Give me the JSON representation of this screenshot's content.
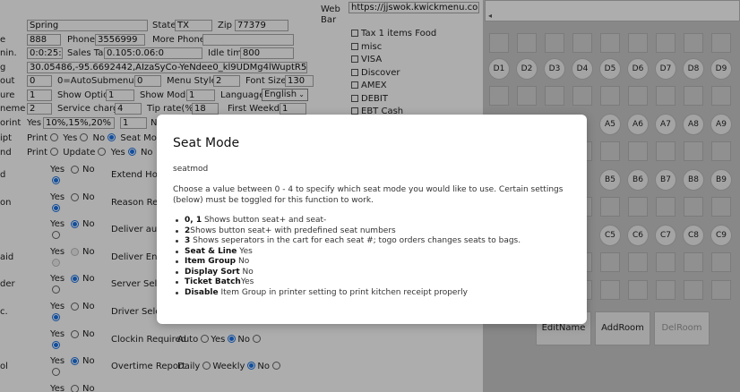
{
  "left": {
    "row1": {
      "edge": "",
      "city": "Spring",
      "state_label": "State",
      "state": "TX",
      "zip_label": "Zip",
      "zip": "77379"
    },
    "row2": {
      "edge": "e",
      "value1": "888",
      "phone_label": "Phone",
      "phone": "3556999",
      "more_phones_label": "More Phones",
      "more_phones": ""
    },
    "row3": {
      "edge": "nin.",
      "value1": "0:0:25:2",
      "sales_tax_label": "Sales Tax",
      "sales_tax": "0.105:0.06:0",
      "idle_label": "Idle time",
      "idle": "800"
    },
    "row4": {
      "edge": "g",
      "value1": "30.05486,-95.6692442,AIzaSyCo-YeNdee0_kl9UDMg4lWuptR5dTggku"
    },
    "row5": {
      "edge": "out",
      "value1": "0",
      "auto_label": "0=Auto",
      "submenu_label": "Submenu",
      "submenu": "0",
      "menu_style_label": "Menu Style",
      "menu_style": "2",
      "font_size_label": "Font Size",
      "font_size": "130"
    },
    "row6": {
      "edge": "ure",
      "value1": "1",
      "show_option_label": "Show Option",
      "show_option": "1",
      "show_modify_label": "Show Modify",
      "show_modify": "1",
      "language_label": "Language",
      "language": "English"
    },
    "row7": {
      "edge": "neme",
      "value1": "2",
      "service_charge_label": "Service charge",
      "service_charge": "4",
      "tip_rate_label": "Tip rate(%)",
      "tip_rate": "18",
      "first_weekday_label": "First Weekday",
      "first_weekday": "1"
    },
    "row8": {
      "edge": "orint",
      "yes_label": "Yes",
      "yes_value": "10%,15%,20%",
      "value2": "1",
      "trail": "N"
    },
    "row9": {
      "edge": "ipt",
      "print_label": "Print",
      "yes": "Yes",
      "no": "No",
      "trail": "Seat Mo"
    },
    "row10": {
      "edge": "nd",
      "print_label": "Print",
      "update": "Update",
      "yes": "Yes",
      "trail": "No"
    },
    "rows": [
      {
        "edge": "d",
        "yes": "Yes",
        "no": "No",
        "label": "Extend Hour"
      },
      {
        "edge": "on",
        "yes": "Yes",
        "no": "No",
        "label": "Reason Requ"
      },
      {
        "edge": "",
        "yes": "Yes",
        "no": "No",
        "label": "Deliver auto"
      },
      {
        "edge": "aid",
        "yes": "Yes",
        "no": "No",
        "label": "Deliver Enab"
      },
      {
        "edge": "der",
        "yes": "Yes",
        "no": "No",
        "label": "Server Select"
      },
      {
        "edge": "c.",
        "yes": "Yes",
        "no": "No",
        "label": "Driver Select"
      },
      {
        "edge": "",
        "yes": "Yes",
        "no": "No",
        "label": "Clockin Required",
        "opt_auto": "Auto",
        "opt_yes": "Yes",
        "opt_no": "No"
      },
      {
        "edge": "ol",
        "yes": "Yes",
        "no": "No",
        "label": "Overtime Report",
        "opt_daily": "Daily",
        "opt_weekly": "Weekly",
        "opt_no": "No"
      },
      {
        "edge": "",
        "yes": "Yes",
        "no": "No"
      }
    ]
  },
  "mid": {
    "web_label": "Web",
    "web_url": "https://jjswok.kwickmenu.com/",
    "bar_label": "Bar",
    "checkboxes": [
      "Tax 1 items Food",
      "misc",
      "VISA",
      "Discover",
      "AMEX",
      "DEBIT",
      "EBT Cash"
    ]
  },
  "grid": {
    "scroll_mark": "◂",
    "row_d": [
      "D1",
      "D2",
      "D3",
      "D4",
      "D5",
      "D6",
      "D7",
      "D8",
      "D9"
    ],
    "row_a": [
      "A5",
      "A6",
      "A7",
      "A8",
      "A9"
    ],
    "row_b": [
      "B5",
      "B6",
      "B7",
      "B8",
      "B9"
    ],
    "row_c": [
      "C5",
      "C6",
      "C7",
      "C8",
      "C9"
    ],
    "buttons": {
      "edit": "EditName",
      "add": "AddRoom",
      "del": "DelRoom"
    }
  },
  "modal": {
    "title": "Seat Mode",
    "subtitle": "seatmod",
    "description": "Choose a value between 0 - 4 to specify which seat mode you would like to use. Certain settings (below) must be toggled for this function to work.",
    "items": [
      {
        "bold": "0, 1",
        "text": " Shows button seat+ and seat-"
      },
      {
        "bold": "2",
        "text": "Shows button seat+ with predefined seat numbers"
      },
      {
        "bold": "3",
        "text": " Shows seperators in the cart for each seat #; togo orders changes seats to bags."
      },
      {
        "bold": "Seat & Line",
        "text": " Yes"
      },
      {
        "bold": "Item Group",
        "text": " No"
      },
      {
        "bold": "Display Sort",
        "text": " No"
      },
      {
        "bold": "Ticket Batch",
        "text": "Yes"
      },
      {
        "bold": "Disable",
        "text": " Item Group in printer setting to print kitchen receipt properly"
      }
    ]
  }
}
